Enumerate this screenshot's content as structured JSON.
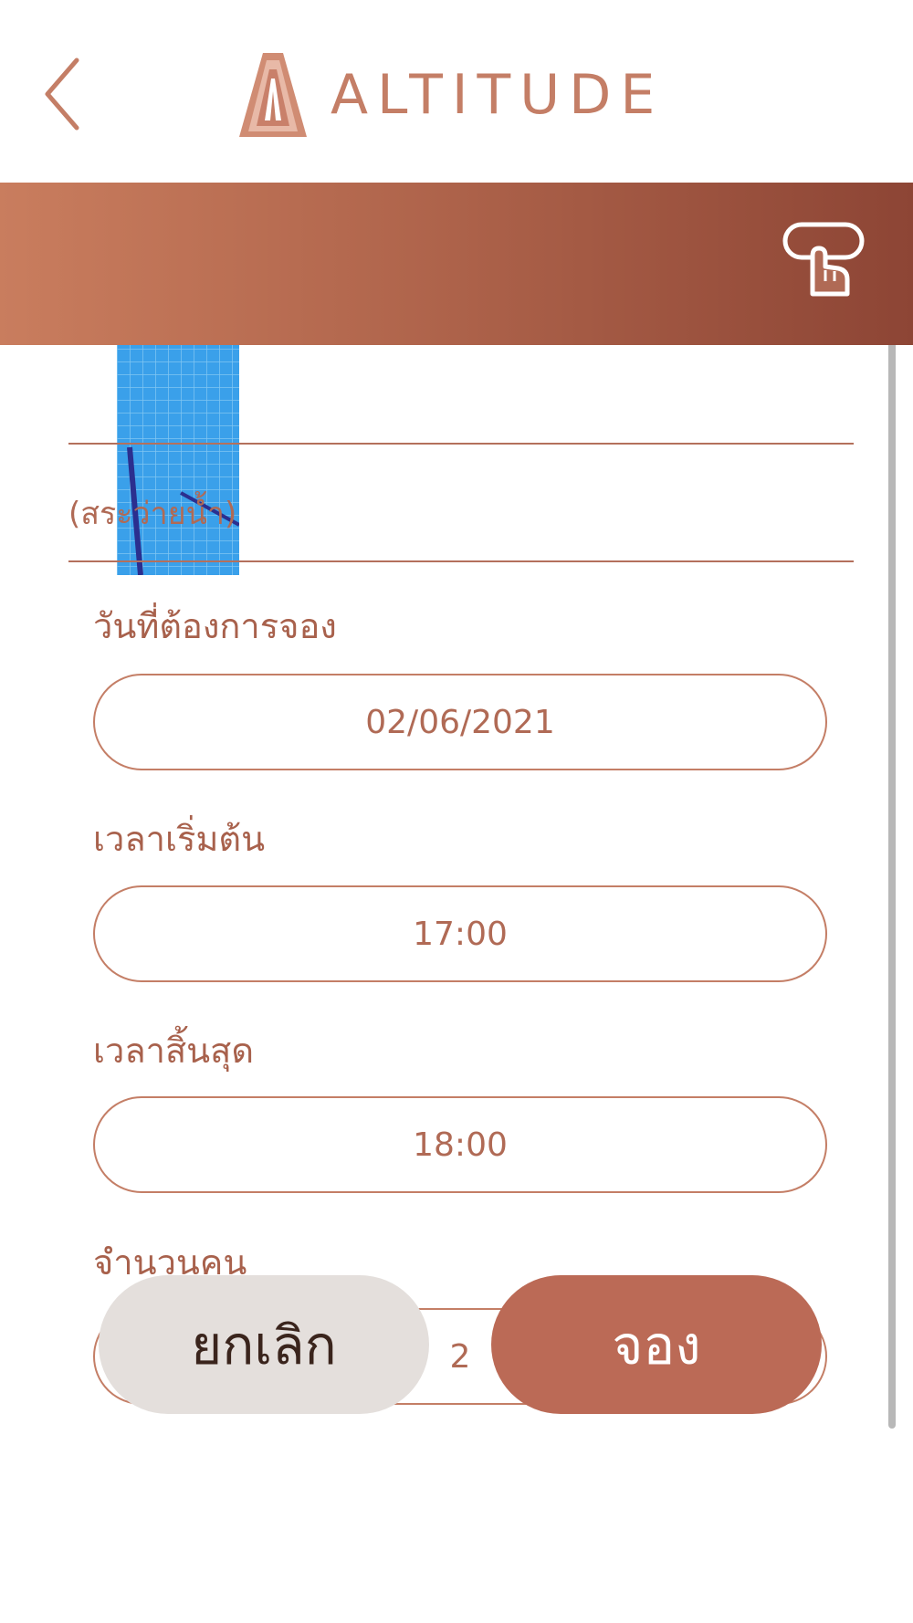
{
  "header": {
    "brand": "ALTITUDE",
    "back_icon": "chevron-left-icon"
  },
  "banner": {
    "gesture_icon": "hand-pointer-icon"
  },
  "facility": {
    "subtitle": "(สระว่ายน้ำ)"
  },
  "form": {
    "date_label": "วันที่ต้องการจอง",
    "date_value": "02/06/2021",
    "start_label": "เวลาเริ่มต้น",
    "start_value": "17:00",
    "end_label": "เวลาสิ้นสุด",
    "end_value": "18:00",
    "people_label": "จำนวนคน",
    "people_value": "2"
  },
  "actions": {
    "cancel_label": "ยกเลิก",
    "book_label": "จอง"
  },
  "colors": {
    "accent": "#bb6a56",
    "text": "#b06a55",
    "banner_start": "#c97d5e",
    "banner_end": "#8d4535",
    "cancel_bg": "#e4dfdc"
  }
}
